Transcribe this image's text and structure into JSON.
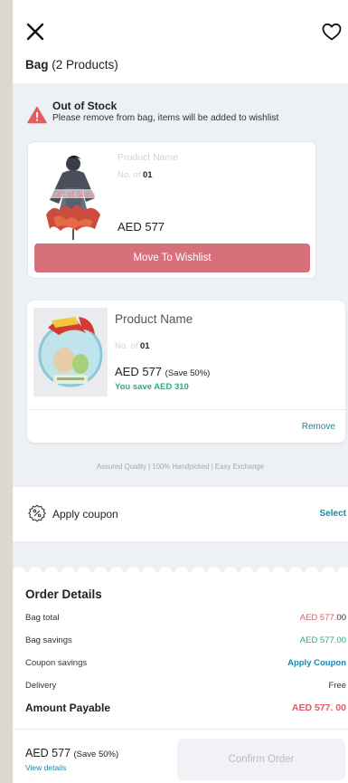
{
  "header": {
    "bag_label": "Bag",
    "product_count": "(2 Products)"
  },
  "oos_banner": {
    "title": "Out of Stock",
    "message": "Please remove from bag, items will be added to wishlist"
  },
  "items": [
    {
      "name": "Product Name",
      "qty_label": "No. of",
      "qty": "01",
      "price": "AED 577",
      "stock_tag": "Out of Stock",
      "action": "Move To Wishlist"
    },
    {
      "name": "Product Name",
      "qty_label": "No. of",
      "qty": "01",
      "price": "AED 577",
      "save_pct": "(Save 50%)",
      "you_save": "You save AED 310",
      "remove": "Remove"
    }
  ],
  "assured": "Assured Quality | 100% Handpicked | Easy Exchange",
  "coupon": {
    "label": "Apply coupon",
    "action": "Select"
  },
  "order": {
    "title": "Order Details",
    "rows": [
      {
        "label": "Bag total",
        "value_main": "AED 577.",
        "value_tail": "00"
      },
      {
        "label": "Bag savings",
        "value": "AED 577.00"
      },
      {
        "label": "Coupon savings",
        "value": "Apply Coupon"
      },
      {
        "label": "Delivery",
        "value": "Free"
      }
    ],
    "payable_label": "Amount Payable",
    "payable_value": "AED 577. 00"
  },
  "footer": {
    "price": "AED 577",
    "save_pct": "(Save 50%)",
    "view_details": "View details",
    "confirm": "Confirm Order"
  },
  "colors": {
    "accent_link": "#1a88a6",
    "wishlist_button": "#d7707a",
    "price_red": "#e05a66",
    "savings_green": "#27b06c"
  }
}
